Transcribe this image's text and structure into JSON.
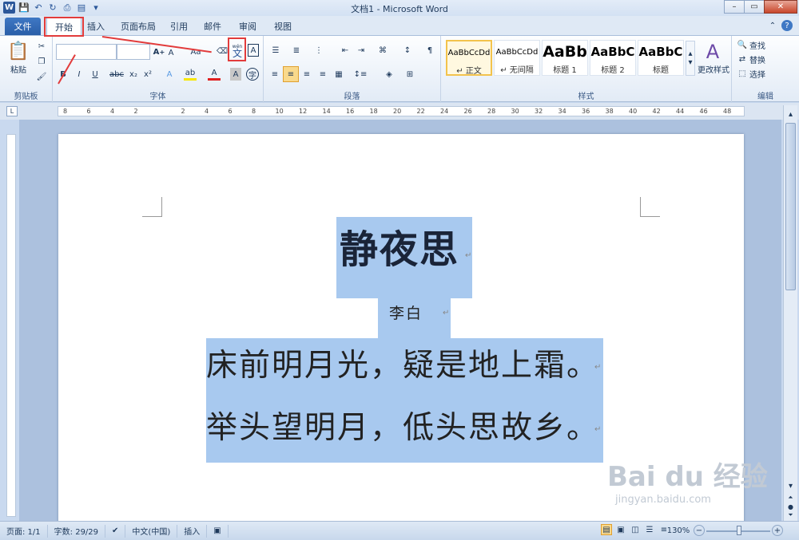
{
  "window": {
    "title": "文档1 - Microsoft Word"
  },
  "tabs": [
    "文件",
    "开始",
    "插入",
    "页面布局",
    "引用",
    "邮件",
    "审阅",
    "视图"
  ],
  "ribbon": {
    "clipboard": {
      "label": "剪贴板",
      "paste": "粘贴"
    },
    "font": {
      "label": "字体",
      "wen": "文",
      "wen_top": "wén"
    },
    "paragraph": {
      "label": "段落"
    },
    "styles": {
      "label": "样式",
      "items": [
        {
          "preview": "AaBbCcDd",
          "name": "↵ 正文"
        },
        {
          "preview": "AaBbCcDd",
          "name": "↵ 无间隔"
        },
        {
          "preview": "AaBb",
          "name": "标题 1"
        },
        {
          "preview": "AaBbC",
          "name": "标题 2"
        },
        {
          "preview": "AaBbC",
          "name": "标题"
        }
      ],
      "change": "更改样式"
    },
    "editing": {
      "label": "编辑",
      "find": "查找",
      "replace": "替换",
      "select": "选择"
    }
  },
  "ruler": {
    "numbers": [
      "8",
      "6",
      "4",
      "2",
      "",
      "2",
      "4",
      "6",
      "8",
      "10",
      "12",
      "14",
      "16",
      "18",
      "20",
      "22",
      "24",
      "26",
      "28",
      "30",
      "32",
      "34",
      "36",
      "38",
      "40",
      "42",
      "44",
      "46",
      "48"
    ]
  },
  "document": {
    "title": "静夜思",
    "author": "李白",
    "lines": [
      "床前明月光，疑是地上霜。",
      "举头望明月，低头思故乡。"
    ],
    "para_mark": "↵"
  },
  "status": {
    "page": "页面: 1/1",
    "words": "字数: 29/29",
    "lang": "中文(中国)",
    "mode": "插入",
    "zoom": "130%"
  },
  "watermark": {
    "brand": "Bai du 经验",
    "url": "jingyan.baidu.com"
  }
}
